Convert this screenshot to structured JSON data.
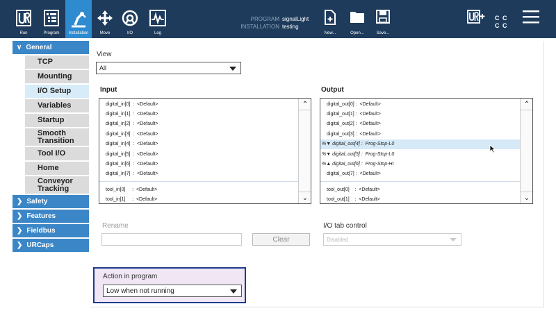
{
  "topbar": {
    "buttons": [
      {
        "label": "Run",
        "icon": "ur-logo-icon"
      },
      {
        "label": "Program",
        "icon": "program-icon"
      },
      {
        "label": "Installation",
        "icon": "installation-icon"
      },
      {
        "label": "Move",
        "icon": "move-icon"
      },
      {
        "label": "I/O",
        "icon": "io-icon"
      },
      {
        "label": "Log",
        "icon": "log-icon"
      }
    ],
    "program_key": "PROGRAM",
    "program_value": "signalLight",
    "installation_key": "INSTALLATION",
    "installation_value": "testing",
    "file_buttons": [
      {
        "label": "New...",
        "icon": "new-file-icon"
      },
      {
        "label": "Open...",
        "icon": "open-folder-icon"
      },
      {
        "label": "Save...",
        "icon": "save-icon"
      }
    ],
    "speed_line1": "C C",
    "speed_line2": "C C",
    "accent": "#2e8bd0",
    "background": "#1e3b5c"
  },
  "sidebar": {
    "general": "General",
    "general_items": [
      {
        "label": "TCP"
      },
      {
        "label": "Mounting"
      },
      {
        "label": "I/O Setup"
      },
      {
        "label": "Variables"
      },
      {
        "label": "Startup"
      },
      {
        "label": "Smooth Transition"
      },
      {
        "label": "Tool I/O"
      },
      {
        "label": "Home"
      },
      {
        "label": "Conveyor Tracking"
      }
    ],
    "sections": [
      {
        "label": "Safety"
      },
      {
        "label": "Features"
      },
      {
        "label": "Fieldbus"
      },
      {
        "label": "URCaps"
      }
    ]
  },
  "main": {
    "view_label": "View",
    "view_value": "All",
    "input_label": "Input",
    "output_label": "Output",
    "inputs": [
      "digital_in[0]  :  <Default>",
      "digital_in[1]  :  <Default>",
      "digital_in[2]  :  <Default>",
      "digital_in[3]  :  <Default>",
      "digital_in[4]  :  <Default>",
      "digital_in[5]  :  <Default>",
      "digital_in[6]  :  <Default>",
      "digital_in[7]  :  <Default>"
    ],
    "tool_inputs": [
      "tool_in[0]     :  <Default>",
      "tool_in[1]     :  <Default>"
    ],
    "outputs": [
      "digital_out[0] :  <Default>",
      "digital_out[1] :  <Default>",
      "digital_out[2] :  <Default>",
      "digital_out[3] :  <Default>",
      "%▼ digital_out[4] :  Prog-Stop-L0",
      "%▼ digital_out[5] :  Prog-Stop-L0",
      "%▲ digital_out[6] :  Prog-Stop-HI",
      "digital_out[7] :  <Default>"
    ],
    "tool_outputs": [
      "tool_out[0]    :  <Default>",
      "tool_out[1]    :  <Default>"
    ],
    "rename_label": "Rename",
    "clear_label": "Clear",
    "io_tab_control_label": "I/O tab control",
    "io_tab_control_value": "Disabled",
    "action_label": "Action in program",
    "action_value": "Low when not running"
  }
}
